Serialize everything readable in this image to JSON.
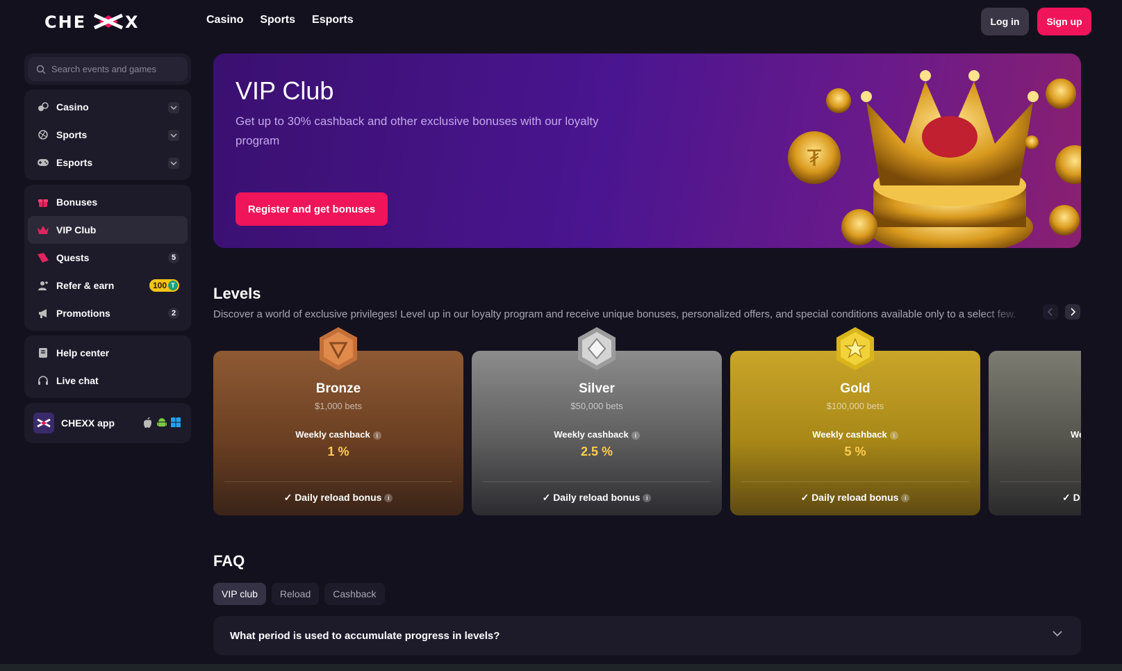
{
  "header": {
    "logo_text": "CHEXX",
    "nav": [
      "Casino",
      "Sports",
      "Esports"
    ],
    "login_label": "Log in",
    "signup_label": "Sign up"
  },
  "sidebar": {
    "search_placeholder": "Search events and games",
    "games": [
      {
        "label": "Casino",
        "icon": "casino-icon"
      },
      {
        "label": "Sports",
        "icon": "sports-icon"
      },
      {
        "label": "Esports",
        "icon": "gamepad-icon"
      }
    ],
    "rewards": [
      {
        "label": "Bonuses",
        "icon": "gift-icon"
      },
      {
        "label": "VIP Club",
        "icon": "crown-icon"
      },
      {
        "label": "Quests",
        "icon": "quest-icon",
        "count": "5"
      },
      {
        "label": "Refer & earn",
        "icon": "user-add-icon",
        "badge": "100",
        "badge_token": "T"
      },
      {
        "label": "Promotions",
        "icon": "megaphone-icon",
        "count": "2"
      }
    ],
    "support": [
      {
        "label": "Help center",
        "icon": "book-icon"
      },
      {
        "label": "Live chat",
        "icon": "headset-icon"
      }
    ],
    "app_label": "CHEXX app"
  },
  "hero": {
    "title": "VIP Club",
    "subtitle": "Get up to 30% cashback and other exclusive bonuses with our loyalty program",
    "cta": "Register and get bonuses"
  },
  "levels": {
    "title": "Levels",
    "description": "Discover a world of exclusive privileges! Level up in our loyalty program and receive unique bonuses, personalized offers, and special conditions available only to a select few.",
    "cards": [
      {
        "name": "Bronze",
        "bets": "$1,000 bets",
        "weekly_label": "Weekly cashback",
        "weekly_value": "1 %",
        "daily": "Daily reload bonus"
      },
      {
        "name": "Silver",
        "bets": "$50,000 bets",
        "weekly_label": "Weekly cashback",
        "weekly_value": "2.5 %",
        "daily": "Daily reload bonus"
      },
      {
        "name": "Gold",
        "bets": "$100,000 bets",
        "weekly_label": "Weekly cashback",
        "weekly_value": "5 %",
        "daily": "Daily reload bonus"
      },
      {
        "name": "",
        "bets": "",
        "weekly_label": "We",
        "weekly_value": "",
        "daily": "D"
      }
    ]
  },
  "faq": {
    "title": "FAQ",
    "tabs": [
      "VIP club",
      "Reload",
      "Cashback"
    ],
    "question": "What period is used to accumulate progress in levels?"
  },
  "colors": {
    "accent": "#f0145a",
    "background": "#14111f",
    "panel": "#1d1a2a",
    "cashback": "#ffcd4d"
  }
}
